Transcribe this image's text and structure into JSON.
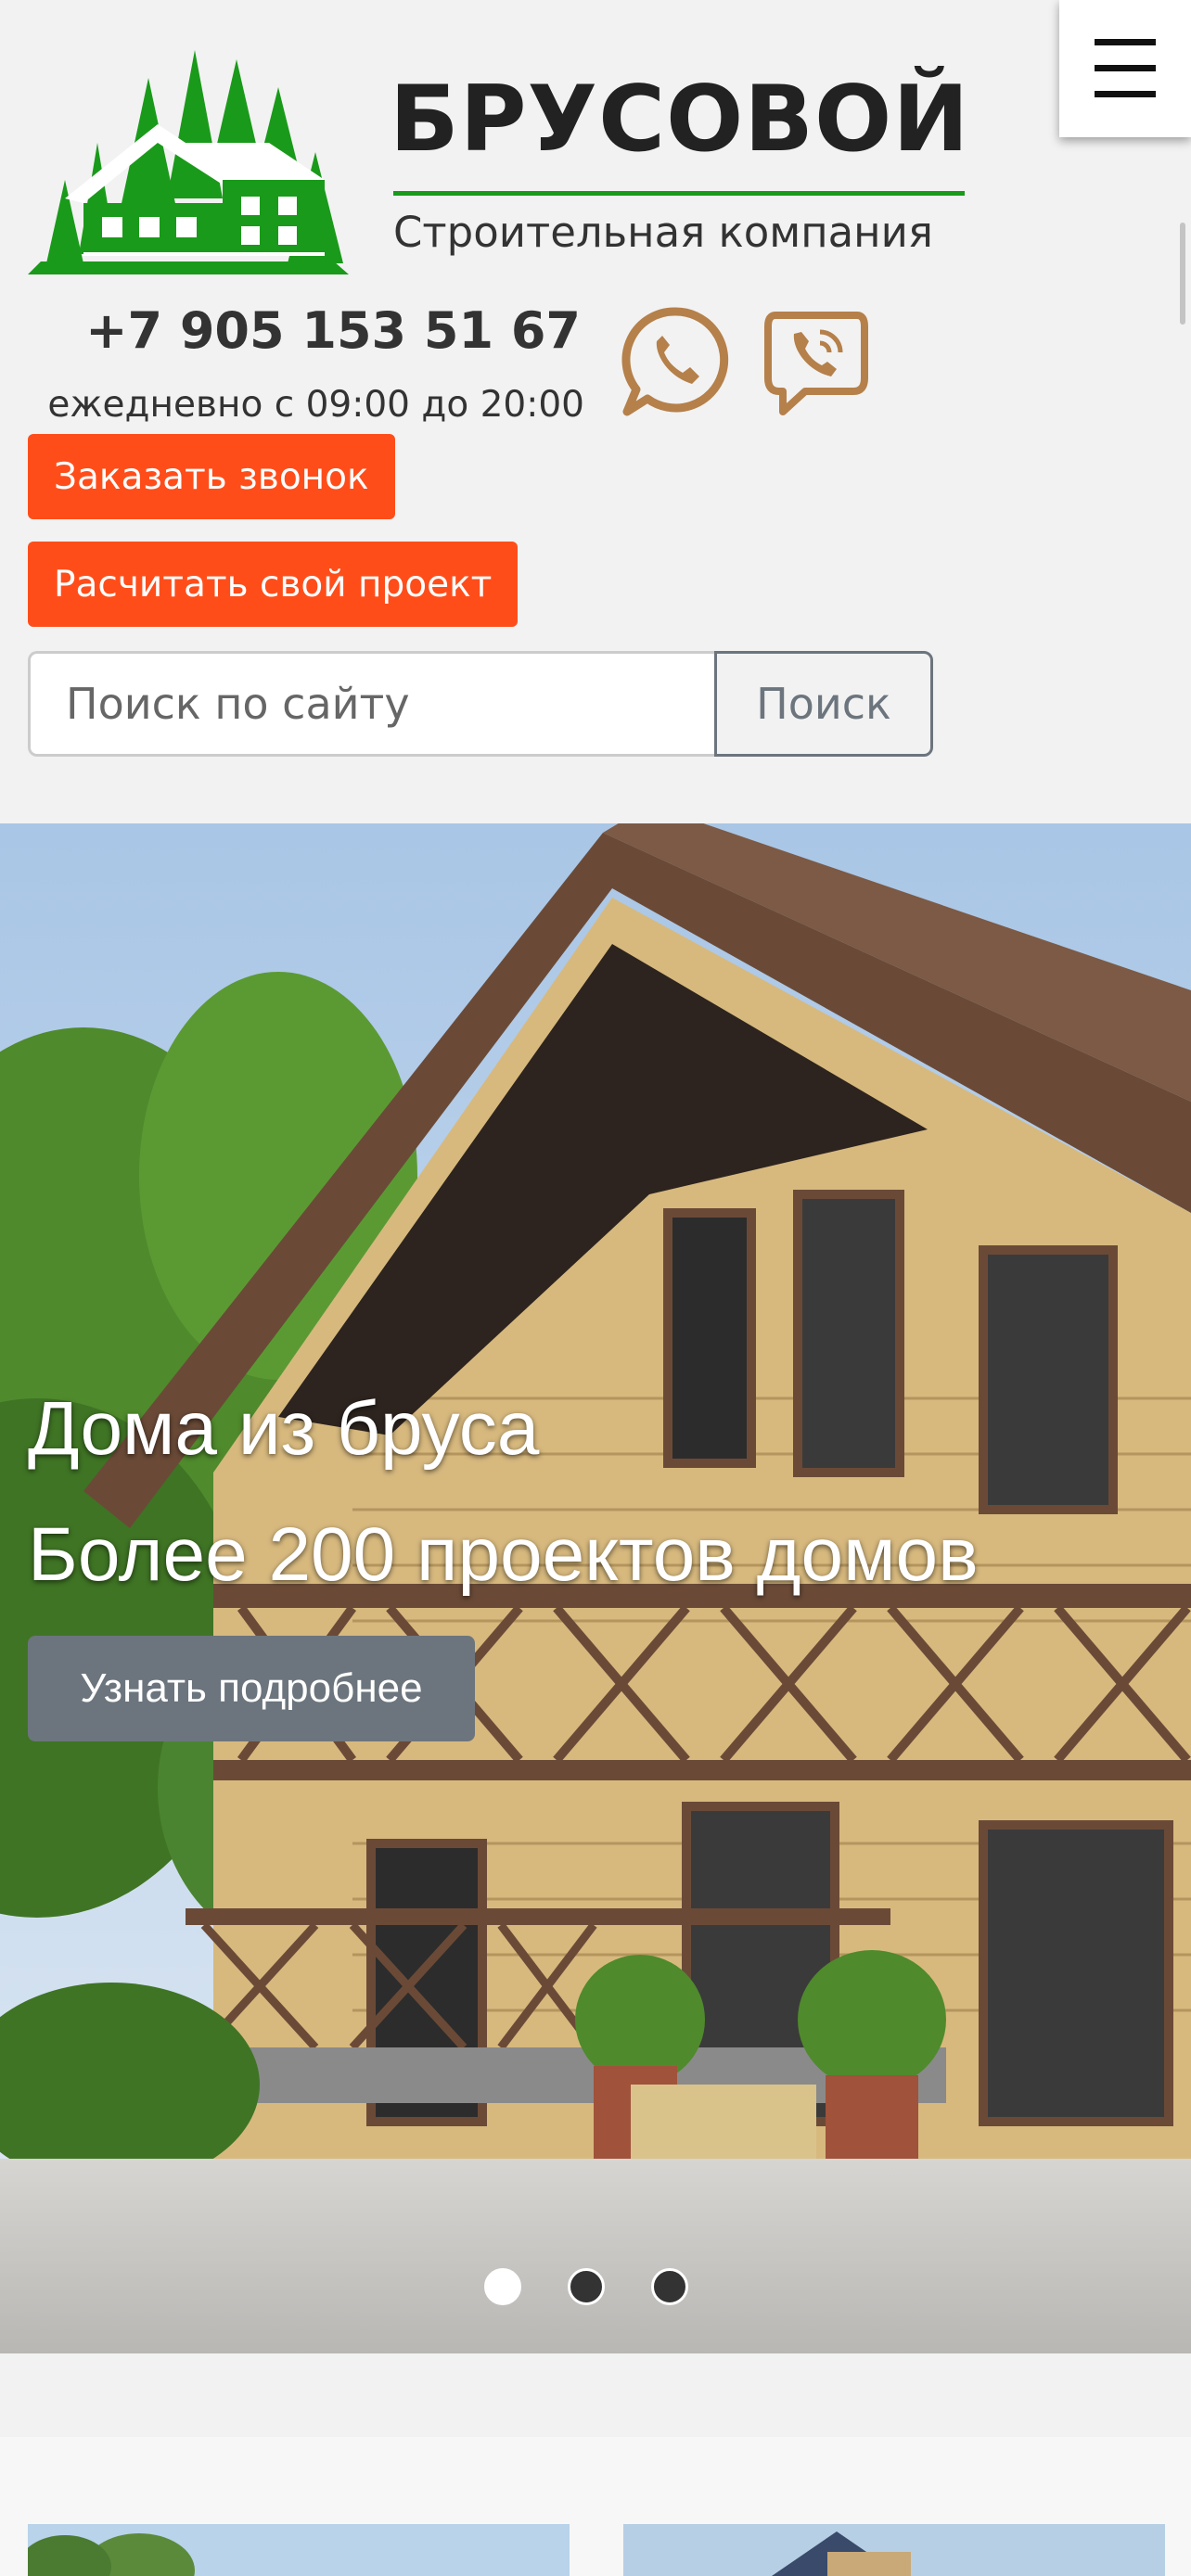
{
  "header": {
    "brand_name": "БРУСОВОЙ",
    "brand_subtitle": "Строительная компания",
    "phone": "+7 905 153 51 67",
    "hours": "ежедневно с 09:00 до 20:00",
    "messengers": [
      "whatsapp-icon",
      "viber-icon"
    ],
    "order_call_label": "Заказать звонок",
    "calc_project_label": "Расчитать свой проект",
    "search_placeholder": "Поиск по сайту",
    "search_button_label": "Поиск"
  },
  "hero": {
    "title": "Дома из бруса",
    "subtitle": "Более 200 проектов домов",
    "button_label": "Узнать подробнее",
    "slide_count": 3,
    "active_slide": 1
  },
  "colors": {
    "brand_green": "#1a9a1a",
    "accent_orange": "#ff4d1a",
    "icon_brown": "#b5804a",
    "secondary_gray": "#6c757d"
  }
}
